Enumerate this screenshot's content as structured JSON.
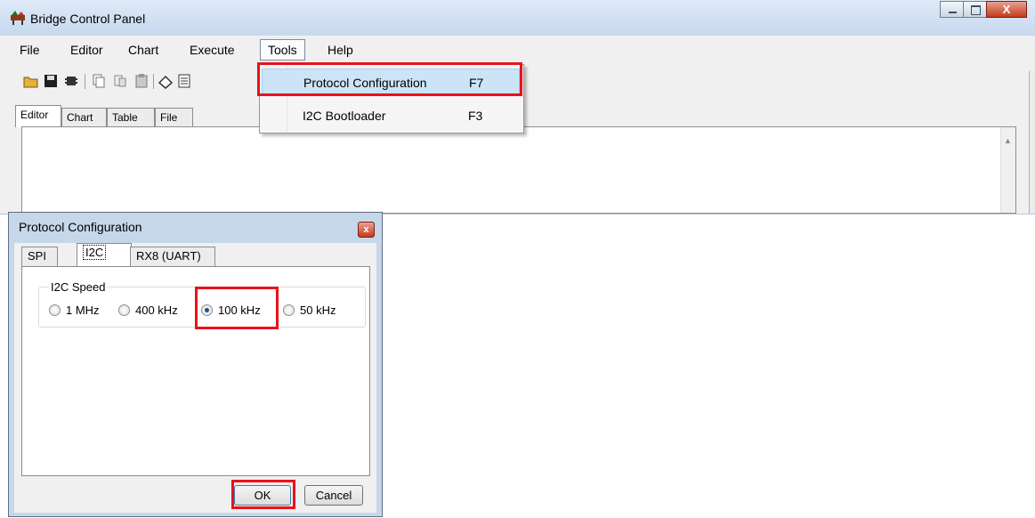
{
  "window": {
    "title": "Bridge Control Panel",
    "controls": {
      "minimize": "minimize-icon",
      "maximize": "maximize-icon",
      "close": "X"
    }
  },
  "menu": {
    "items": [
      "File",
      "Editor",
      "Chart",
      "Execute",
      "Tools",
      "Help"
    ],
    "open_menu": "Tools"
  },
  "toolbar": {
    "icons": [
      "open-folder-icon",
      "save-icon",
      "chip-icon",
      "copy-icon",
      "cut-icon",
      "paste-icon",
      "eraser-icon",
      "list-icon"
    ]
  },
  "editor_tabs": [
    "Editor",
    "Chart",
    "Table",
    "File"
  ],
  "tools_dropdown": {
    "items": [
      {
        "label": "Protocol Configuration",
        "shortcut": "F7",
        "highlighted": true
      },
      {
        "label": "I2C Bootloader",
        "shortcut": "F3",
        "highlighted": false
      }
    ]
  },
  "dialog": {
    "title": "Protocol Configuration",
    "close": "x",
    "tabs": [
      "SPI",
      "I2C",
      "RX8 (UART)"
    ],
    "active_tab": "I2C",
    "group_label": "I2C Speed",
    "speed_options": [
      "1 MHz",
      "400 kHz",
      "100 kHz",
      "50 kHz"
    ],
    "selected_speed": "100 kHz",
    "ok_label": "OK",
    "cancel_label": "Cancel"
  },
  "highlight_color": "#e8121b"
}
